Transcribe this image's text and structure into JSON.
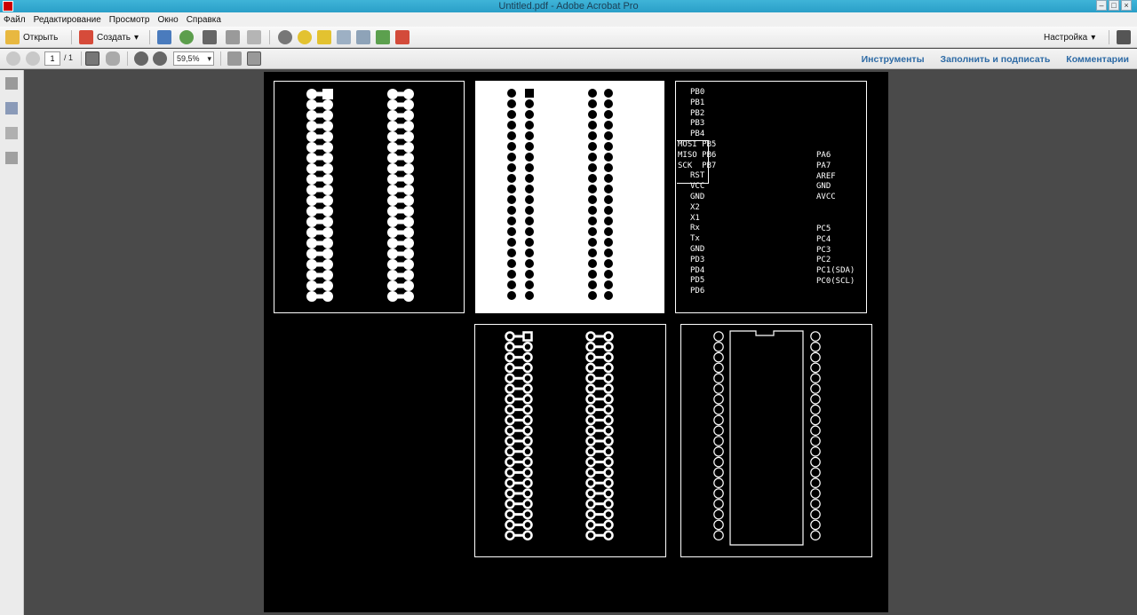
{
  "window": {
    "title": "Untitled.pdf - Adobe Acrobat Pro"
  },
  "menu": [
    "Файл",
    "Редактирование",
    "Просмотр",
    "Окно",
    "Справка"
  ],
  "toolbar": {
    "open_label": "Открыть",
    "create_label": "Создать",
    "customize_label": "Настройка"
  },
  "nav": {
    "page_current": "1",
    "page_total": "/ 1",
    "zoom": "59,5%"
  },
  "right_links": {
    "tools": "Инструменты",
    "fill_sign": "Заполнить и подписать",
    "comments": "Комментарии"
  },
  "pcb": {
    "labels_left": [
      "PB0",
      "PB1",
      "PB2",
      "PB3",
      "PB4",
      "MOSI PB5",
      "MISO PB6",
      "SCK  PB7",
      "RST",
      "VCC",
      "GND",
      "X2",
      "X1",
      "Rx",
      "Tx",
      "GND",
      "PD3",
      "PD4",
      "PD5",
      "PD6"
    ],
    "labels_right": [
      "PA6",
      "PA7",
      "AREF",
      "GND",
      "AVCC",
      "PC5",
      "PC4",
      "PC3",
      "PC2",
      "PC1(SDA)",
      "PC0(SCL)"
    ]
  },
  "colors": {
    "accent": "#2d6aa5",
    "titlebar": "#2a9fc8"
  }
}
